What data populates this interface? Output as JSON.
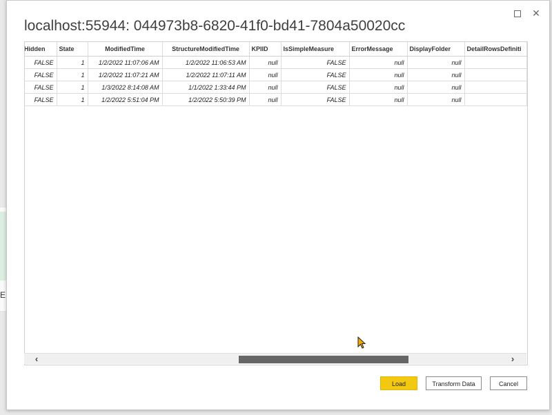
{
  "dialog": {
    "title": "localhost:55944: 044973b8-6820-41f0-bd41-7804a50020cc",
    "window_controls": {
      "maximize_icon": "maximize-icon",
      "close_icon": "close-icon",
      "close_glyph": "✕"
    }
  },
  "background": {
    "letter": "E"
  },
  "table": {
    "columns": [
      "Hidden",
      "State",
      "ModifiedTime",
      "StructureModifiedTime",
      "KPIID",
      "IsSimpleMeasure",
      "ErrorMessage",
      "DisplayFolder",
      "DetailRowsDefiniti"
    ],
    "rows": [
      [
        "FALSE",
        "1",
        "1/2/2022 11:07:06 AM",
        "1/2/2022 11:06:53 AM",
        "null",
        "FALSE",
        "null",
        "null",
        ""
      ],
      [
        "FALSE",
        "1",
        "1/2/2022 11:07:21 AM",
        "1/2/2022 11:07:11 AM",
        "null",
        "FALSE",
        "null",
        "null",
        ""
      ],
      [
        "FALSE",
        "1",
        "1/3/2022 8:14:08 AM",
        "1/1/2022 1:33:44 PM",
        "null",
        "FALSE",
        "null",
        "null",
        ""
      ],
      [
        "FALSE",
        "1",
        "1/2/2022 5:51:04 PM",
        "1/2/2022 5:50:39 PM",
        "null",
        "FALSE",
        "null",
        "null",
        ""
      ]
    ]
  },
  "scrollbar": {
    "left_arrow": "‹",
    "right_arrow": "›"
  },
  "buttons": {
    "load": "Load",
    "transform": "Transform Data",
    "cancel": "Cancel"
  },
  "colors": {
    "load_accent": "#f2c811",
    "scroll_thumb": "#666666",
    "cursor": "#f2a900"
  }
}
